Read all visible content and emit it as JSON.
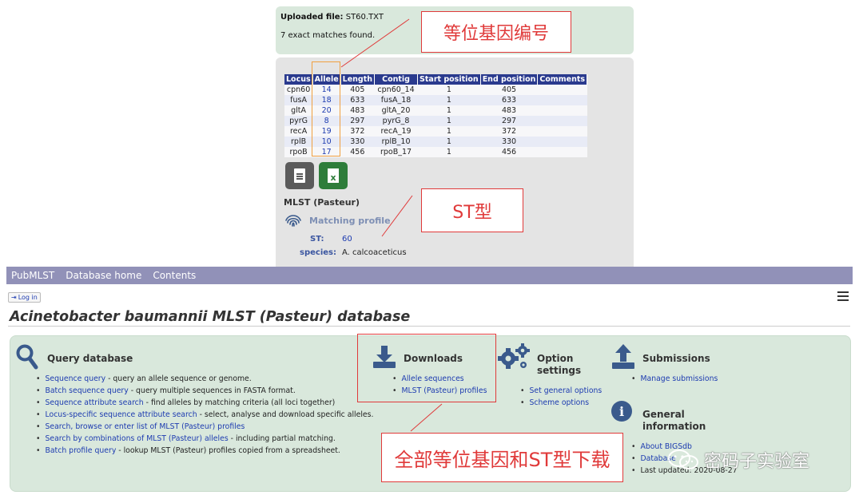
{
  "results": {
    "upload_label": "Uploaded file:",
    "upload_file": "ST60.TXT",
    "matches_text": "7 exact matches found.",
    "columns": [
      "Locus",
      "Allele",
      "Length",
      "Contig",
      "Start position",
      "End position",
      "Comments"
    ],
    "rows": [
      {
        "locus": "cpn60",
        "allele": "14",
        "length": "405",
        "contig": "cpn60_14",
        "start": "1",
        "end": "405",
        "comments": ""
      },
      {
        "locus": "fusA",
        "allele": "18",
        "length": "633",
        "contig": "fusA_18",
        "start": "1",
        "end": "633",
        "comments": ""
      },
      {
        "locus": "gltA",
        "allele": "20",
        "length": "483",
        "contig": "gltA_20",
        "start": "1",
        "end": "483",
        "comments": ""
      },
      {
        "locus": "pyrG",
        "allele": "8",
        "length": "297",
        "contig": "pyrG_8",
        "start": "1",
        "end": "297",
        "comments": ""
      },
      {
        "locus": "recA",
        "allele": "19",
        "length": "372",
        "contig": "recA_19",
        "start": "1",
        "end": "372",
        "comments": ""
      },
      {
        "locus": "rplB",
        "allele": "10",
        "length": "330",
        "contig": "rplB_10",
        "start": "1",
        "end": "330",
        "comments": ""
      },
      {
        "locus": "rpoB",
        "allele": "17",
        "length": "456",
        "contig": "rpoB_17",
        "start": "1",
        "end": "456",
        "comments": ""
      }
    ],
    "export_text_icon": "text-file-icon",
    "export_excel_icon": "excel-file-icon",
    "scheme_title": "MLST (Pasteur)",
    "matching_profile": "Matching profile",
    "st_label": "ST:",
    "st_value": "60",
    "species_label": "species:",
    "species_value": "A. calcoaceticus"
  },
  "annotations": {
    "allele_number": "等位基因编号",
    "st_type": "ST型",
    "download_all": "全部等位基因和ST型下载",
    "color": "#e03a3a"
  },
  "nav": {
    "items": [
      "PubMLST",
      "Database home",
      "Contents"
    ],
    "login": "Log in",
    "menu_icon": "hamburger-menu-icon"
  },
  "page": {
    "title": "Acinetobacter baumannii MLST (Pasteur) database"
  },
  "query": {
    "title": "Query database",
    "items": [
      {
        "link": "Sequence query",
        "desc": " - query an allele sequence or genome."
      },
      {
        "link": "Batch sequence query",
        "desc": " - query multiple sequences in FASTA format."
      },
      {
        "link": "Sequence attribute search",
        "desc": " - find alleles by matching criteria (all loci together)"
      },
      {
        "link": "Locus-specific sequence attribute search",
        "desc": " - select, analyse and download specific alleles."
      },
      {
        "link": "Search, browse or enter list of MLST (Pasteur) profiles",
        "desc": ""
      },
      {
        "link": "Search by combinations of MLST (Pasteur) alleles",
        "desc": " - including partial matching."
      },
      {
        "link": "Batch profile query",
        "desc": " - lookup MLST (Pasteur) profiles copied from a spreadsheet."
      }
    ]
  },
  "downloads": {
    "title": "Downloads",
    "items": [
      "Allele sequences",
      "MLST (Pasteur) profiles"
    ]
  },
  "options": {
    "title_1": "Option",
    "title_2": "settings",
    "items": [
      "Set general options",
      "Scheme options"
    ]
  },
  "submissions": {
    "title": "Submissions",
    "items": [
      "Manage submissions"
    ]
  },
  "general": {
    "title_1": "General",
    "title_2": "information",
    "items": [
      "About BIGSdb",
      "Database",
      "Last updated: 2020-08-27"
    ]
  },
  "watermark": {
    "text": "密码子实验室",
    "icon": "wechat-icon"
  },
  "colors": {
    "nav_bar": "#9191b8",
    "table_header": "#2a3a8e",
    "panel_green": "#d9e8dc",
    "link_blue": "#1d3bb0",
    "icon_blue": "#3a5a8c"
  }
}
